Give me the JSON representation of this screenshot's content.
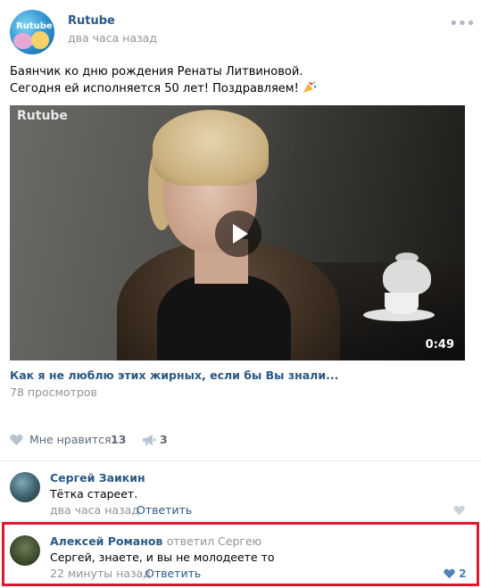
{
  "post": {
    "author": "Rutube",
    "avatar_logo": "Rutube",
    "time": "два часа назад",
    "more_icon": "more-dots-icon",
    "text_line1": "Баянчик ко дню рождения Ренаты Литвиновой.",
    "text_line2": "Сегодня ей исполняется 50 лет! Поздравляем!",
    "text_emoji": "party-popper-icon"
  },
  "video": {
    "logo": "Rutube",
    "duration": "0:49",
    "title": "Как я не люблю этих жирных, если бы Вы знали...",
    "views": "78 просмотров"
  },
  "actions": {
    "like_label": "Мне нравится",
    "like_count": "13",
    "share_count": "3"
  },
  "comments": [
    {
      "author": "Сергей Заикин",
      "replied_to": "",
      "text": "Тётка стареет.",
      "time": "два часа назад",
      "reply_label": "Ответить",
      "likes": ""
    },
    {
      "author": "Алексей Романов",
      "replied_to": "ответил Сергею",
      "text": "Сергей, знаете, и вы не молодеете то",
      "time": "22 минуты назад",
      "reply_label": "Ответить",
      "likes": "2"
    }
  ],
  "colors": {
    "link": "#2a5885",
    "meta": "#939393",
    "highlight": "#e0182f",
    "like_active": "#5181b8"
  }
}
